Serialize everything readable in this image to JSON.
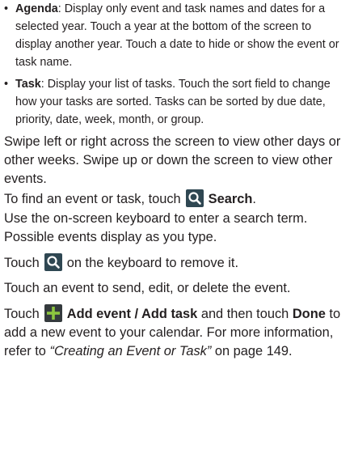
{
  "bullets": [
    {
      "term": "Agenda",
      "text": ": Display only event and task names and dates for a selected year. Touch a year at the bottom of the screen to display another year. Touch a date to hide or show the event or task name."
    },
    {
      "term": "Task",
      "text": ": Display your list of tasks. Touch the sort field to change how your tasks are sorted. Tasks can be sorted by due date, priority, date, week, month, or group."
    }
  ],
  "paragraphs": {
    "swipe": "Swipe left or right across the screen to view other days or other weeks. Swipe up or down the screen to view other events.",
    "find_prefix": "To find an event or task, touch",
    "find_label": "Search",
    "find_suffix": ".",
    "keyboard_line1": "Use the on-screen keyboard to enter a search term.",
    "keyboard_line2": "Possible events display as you type.",
    "touch_prefix": "Touch",
    "touch_suffix": "on the keyboard to remove it.",
    "touch_event": "Touch an event to send, edit, or delete the event.",
    "add_prefix": "Touch",
    "add_label": "Add event / Add task",
    "add_mid": "and then touch",
    "done_label": "Done",
    "add_mid2": "to add a new event to your calendar. For more information, refer to",
    "ref_title": "“Creating an Event or Task”",
    "add_suffix": "on page 149."
  },
  "icons": {
    "search": "search-icon",
    "keyboard_search": "search-icon",
    "add": "plus-icon"
  },
  "colors": {
    "text": "#231f20",
    "icon_search_bg": "#2f4752",
    "icon_add_bg": "#343a3d",
    "add_plus_green": "#8dc63f"
  }
}
